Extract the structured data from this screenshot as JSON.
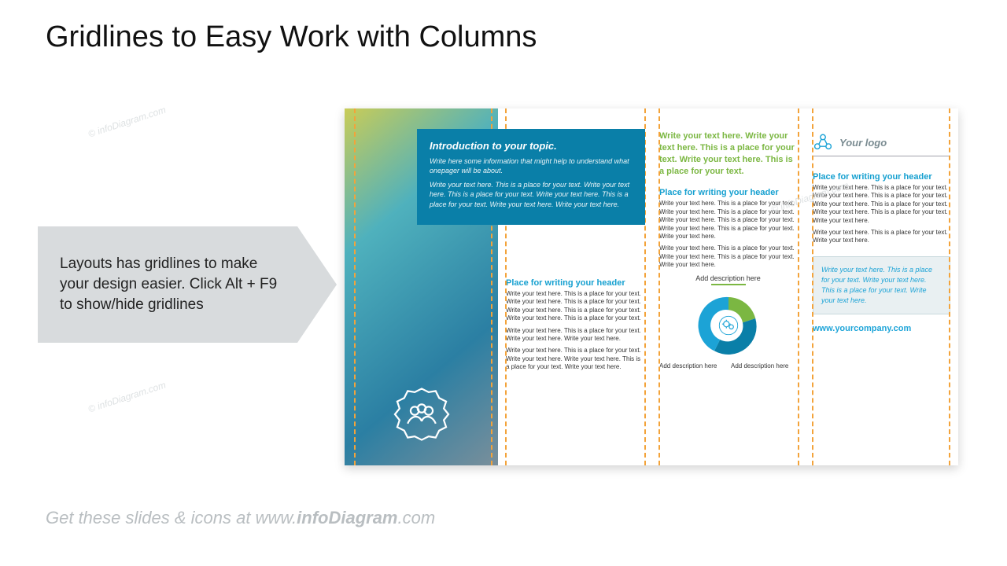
{
  "title": "Gridlines to Easy Work with Columns",
  "callout": "Layouts has gridlines to make your design easier. Click  Alt + F9 to show/hide gridlines",
  "watermark": "© infoDiagram.com",
  "intro": {
    "heading": "Introduction to your topic.",
    "p1": "Write here some information that might help to understand what onepager will be about.",
    "p2": "Write your text here. This is a place for your text. Write your text here. This is a place for your text. Write your text here. This is a place for your text. Write your text here. Write your text here."
  },
  "col2": {
    "header": "Place for writing your header",
    "p1": "Write your text here. This is a place for your text. Write your text here. This is a place for your text. Write your text here. This is a place for your text. Write your text here. This is a place for your text.",
    "p2": "Write your text here. This is a place for your text. Write your text here. Write your text here.",
    "p3": "Write your text here. This is a place for your text. Write your text here. Write your text here. This is a place for your text. Write your text here."
  },
  "col3": {
    "green": "Write your text here. Write your text here. This is a place for your text. Write your text here. This is a place for your text.",
    "header": "Place for writing your header",
    "p1": "Write your text here. This is a place for your text. Write your text here. This is a place for your text. Write your text here. This is a place for your text. Write your text here. This is a place for your text. Write your text here.",
    "p2": "Write your text here. This is a place for your text. Write your text here. This is a place for your text. Write your text here.",
    "desc_top": "Add description here",
    "desc_left": "Add description here",
    "desc_right": "Add description here"
  },
  "col4": {
    "logo_text": "Your logo",
    "header": "Place for writing your header",
    "p1": "Write your text here. This is a place for your text. Write your text here. This is a place for your text. Write your text here. This is a place for your text. Write your text here. This is a place for your text. Write your text here.",
    "p2": "Write your text here. This is a place for your text. Write your text here.",
    "box": "Write your text here. This is a place for your text. Write your text here. This is a place for your text. Write your text here.",
    "site": "www.yourcompany.com"
  },
  "footer": {
    "pre": "Get these slides & icons at ",
    "brand_pre": "www.",
    "brand_bold": "infoDiagram",
    "brand_post": ".com"
  }
}
